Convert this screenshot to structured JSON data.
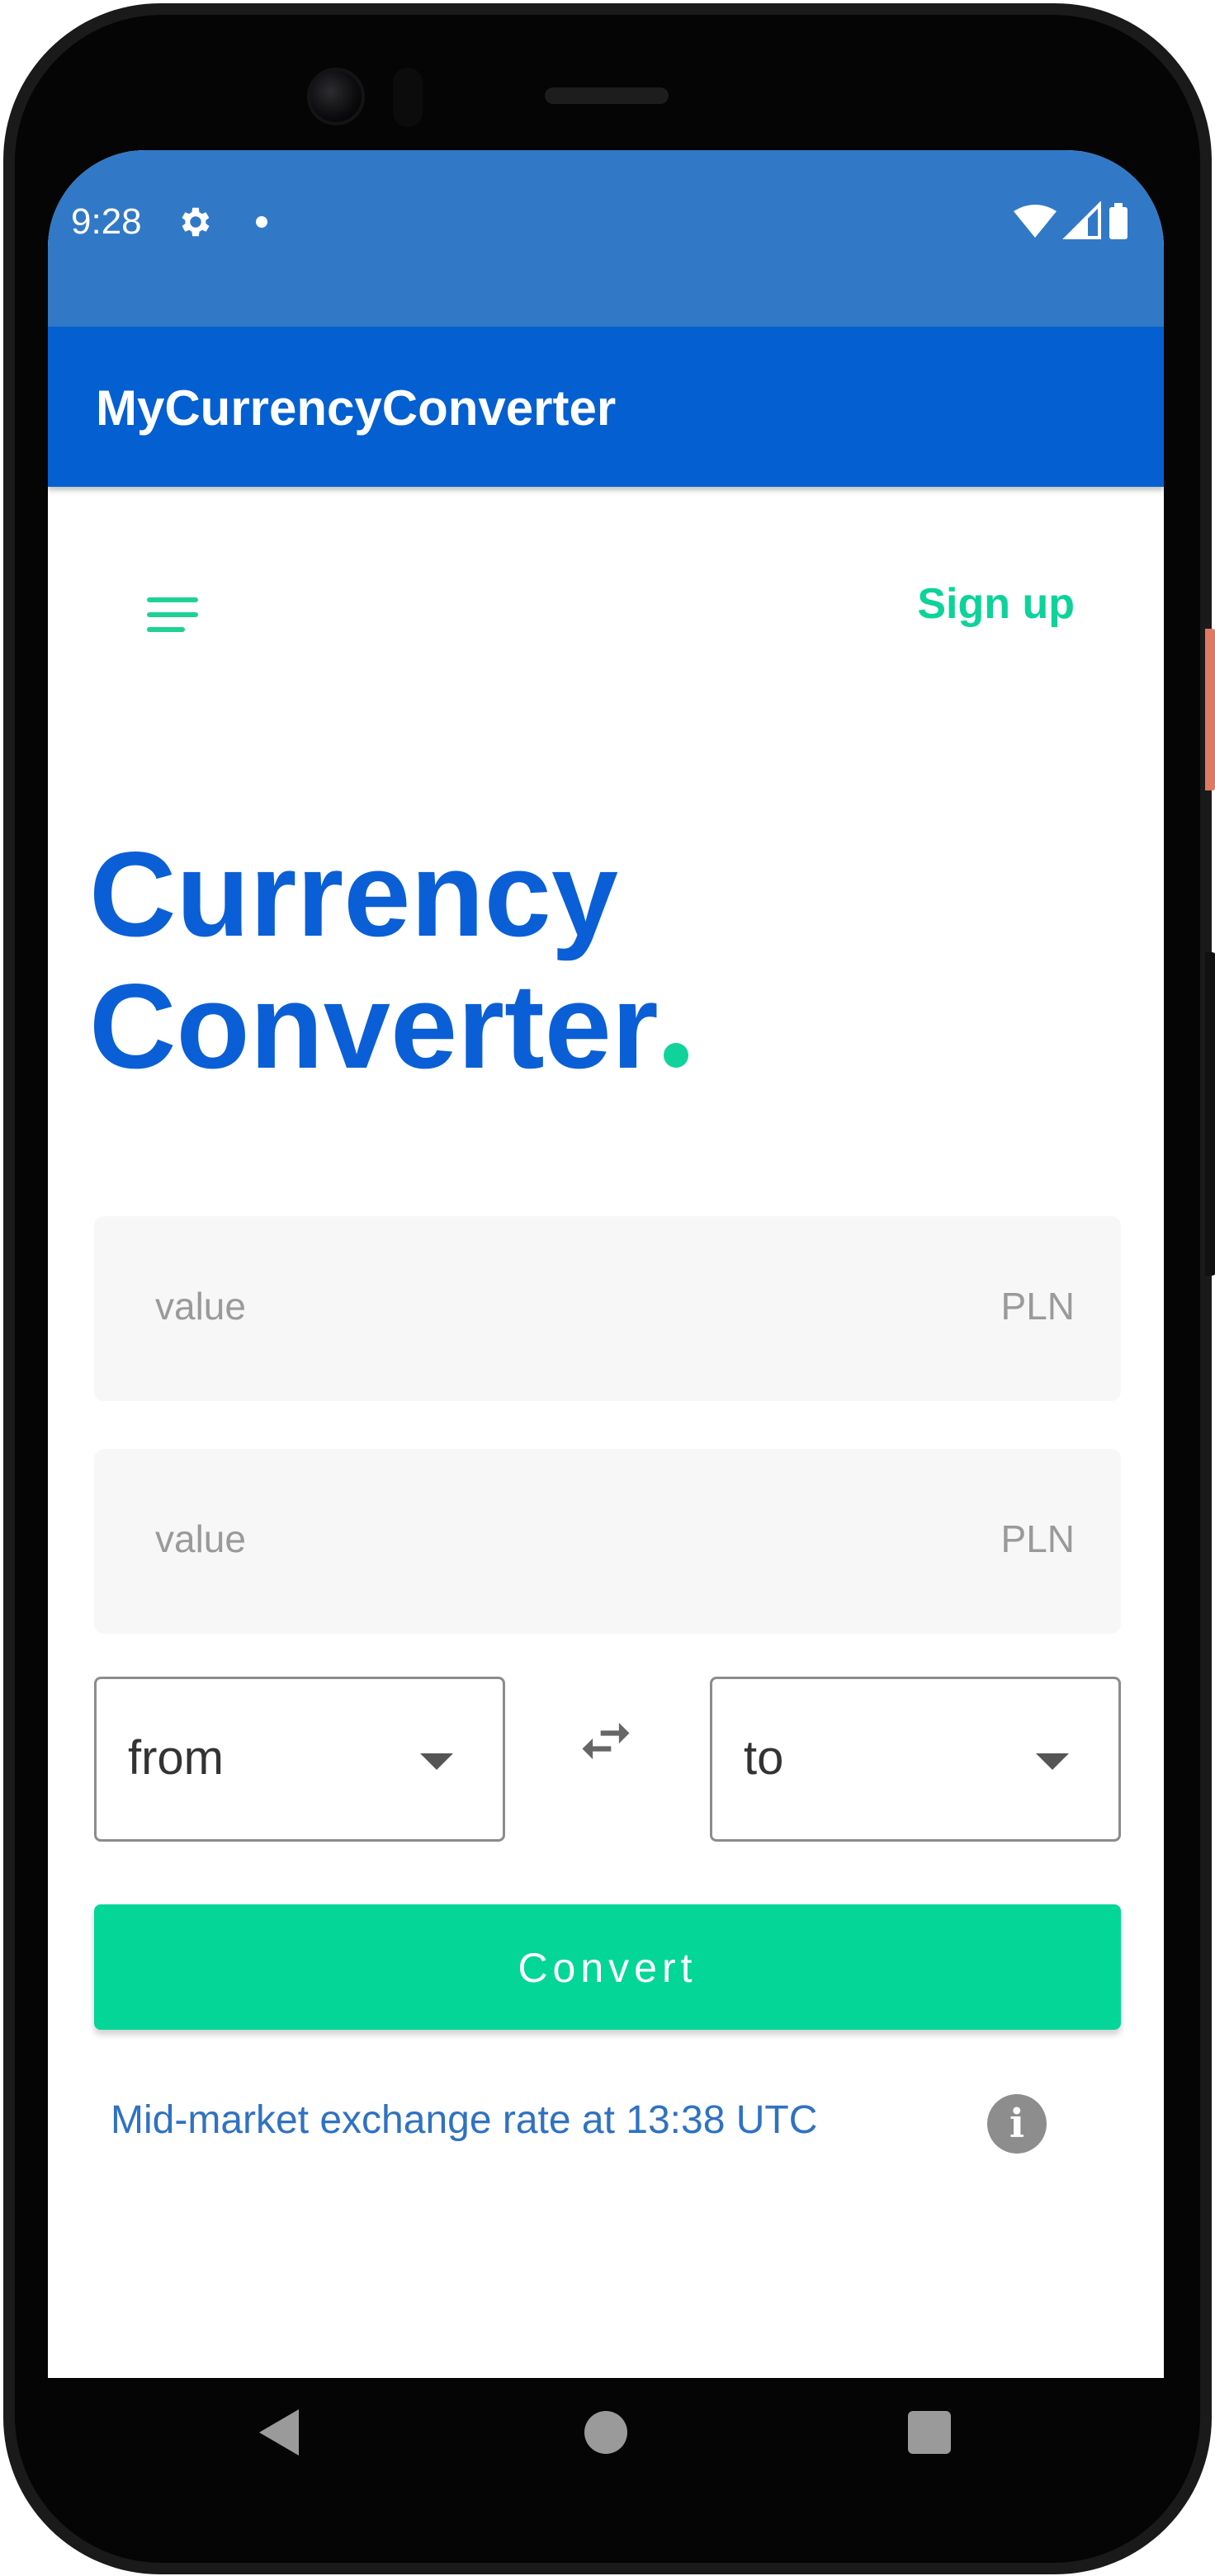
{
  "status_bar": {
    "time": "9:28",
    "icons": [
      "settings-gear-icon",
      "notification-dot-icon",
      "wifi-icon",
      "cellular-signal-icon",
      "battery-icon"
    ]
  },
  "app_bar": {
    "title": "MyCurrencyConverter"
  },
  "header": {
    "menu_icon": "hamburger-menu-icon",
    "signup_label": "Sign up"
  },
  "hero": {
    "line1": "Currency",
    "line2": "Converter"
  },
  "fields": [
    {
      "placeholder": "value",
      "currency": "PLN"
    },
    {
      "placeholder": "value",
      "currency": "PLN"
    }
  ],
  "selects": {
    "from_label": "from",
    "to_label": "to",
    "swap_icon": "swap-arrows-icon"
  },
  "convert_button": {
    "label": "Convert"
  },
  "rate_info": {
    "text": "Mid-market exchange rate at 13:38 UTC",
    "info_glyph": "i"
  },
  "nav": {
    "icons": [
      "back-icon",
      "home-icon",
      "recents-icon"
    ]
  },
  "colors": {
    "status_bar": "#3179c6",
    "app_bar": "#0460d1",
    "accent_green": "#04d698",
    "hero_blue": "#0b5fd6",
    "link_blue": "#2f72c2"
  }
}
